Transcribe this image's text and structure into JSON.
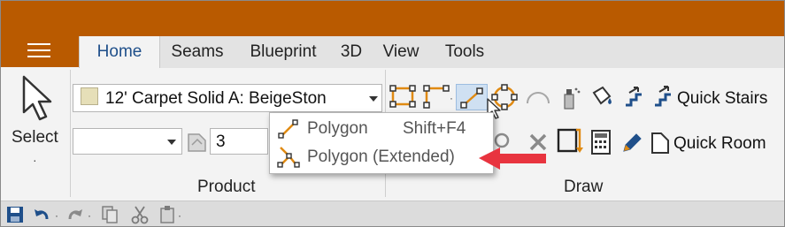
{
  "window": {
    "accent": "#b95a00"
  },
  "tabs": [
    {
      "label": "Home",
      "active": true
    },
    {
      "label": "Seams"
    },
    {
      "label": "Blueprint"
    },
    {
      "label": "3D"
    },
    {
      "label": "View"
    },
    {
      "label": "Tools"
    }
  ],
  "select": {
    "label": "Select",
    "dropdown_glyph": "·"
  },
  "product": {
    "material_value": "12' Carpet Solid A: BeigeSton",
    "second_value": "",
    "number_value": "3",
    "group_label": "Product"
  },
  "draw": {
    "group_label": "Draw",
    "quick_stairs": "Quick Stairs",
    "quick_room": "Quick Room"
  },
  "popup": {
    "items": [
      {
        "label": "Polygon",
        "shortcut": "Shift+F4"
      },
      {
        "label": "Polygon (Extended)",
        "shortcut": ""
      }
    ]
  },
  "colors": {
    "arrow": "#e8343f",
    "orange": "#e08a12",
    "active": "#cfe0f2"
  }
}
